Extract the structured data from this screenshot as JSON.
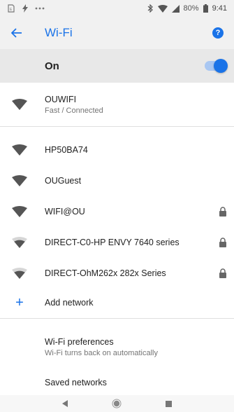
{
  "status_bar": {
    "battery_percent": "80%",
    "time": "9:41",
    "left_icons": [
      "sim-icon",
      "flash-icon",
      "more-dots-icon"
    ],
    "right_icons": [
      "bluetooth-icon",
      "wifi-signal-icon",
      "cell-signal-icon",
      "battery-icon"
    ]
  },
  "app_bar": {
    "title": "Wi-Fi",
    "back_icon": "arrow-back-icon",
    "help_icon": "help-icon",
    "help_glyph": "?"
  },
  "master": {
    "label": "On",
    "enabled": true
  },
  "connected_network": {
    "ssid": "OUWIFI",
    "status": "Fast / Connected"
  },
  "networks": [
    {
      "ssid": "HP50BA74",
      "locked": false,
      "signal": "full"
    },
    {
      "ssid": "OUGuest",
      "locked": false,
      "signal": "full"
    },
    {
      "ssid": "WIFI@OU",
      "locked": true,
      "signal": "full"
    },
    {
      "ssid": "DIRECT-C0-HP ENVY 7640 series",
      "locked": true,
      "signal": "medium"
    },
    {
      "ssid": "DIRECT-OhM262x 282x Series",
      "locked": true,
      "signal": "medium"
    }
  ],
  "add_network": {
    "label": "Add network",
    "icon_glyph": "+"
  },
  "preferences": {
    "title": "Wi-Fi preferences",
    "subtitle": "Wi-Fi turns back on automatically"
  },
  "saved": {
    "title": "Saved networks"
  },
  "colors": {
    "accent": "#1a73e8",
    "header_bg": "#f1f1f1",
    "toggle_bg": "#e8e8e8"
  }
}
